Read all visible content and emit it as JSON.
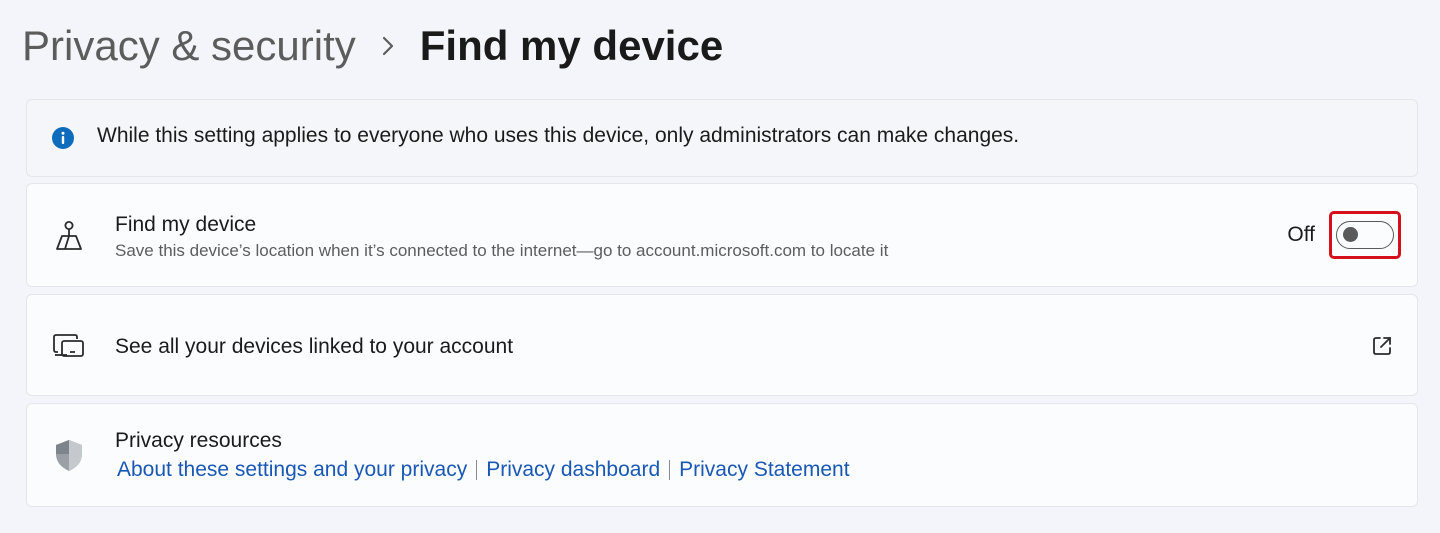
{
  "breadcrumb": {
    "parent": "Privacy & security",
    "current": "Find my device"
  },
  "info": {
    "icon": "info-icon",
    "text": "While this setting applies to everyone who uses this device, only administrators can make changes."
  },
  "find_my_device": {
    "icon": "person-location-icon",
    "title": "Find my device",
    "description": "Save this device’s location when it’s connected to the internet—go to account.microsoft.com to locate it",
    "toggle_state": "Off",
    "toggle_on": false
  },
  "linked_devices": {
    "icon": "devices-icon",
    "title": "See all your devices linked to your account",
    "action_icon": "open-external-icon"
  },
  "privacy_resources": {
    "icon": "shield-icon",
    "title": "Privacy resources",
    "links": [
      "About these settings and your privacy",
      "Privacy dashboard",
      "Privacy Statement"
    ]
  },
  "colors": {
    "accent_link": "#1958b4",
    "info_blue": "#0f6cbd",
    "highlight_red": "#d6101b",
    "background": "#f3f5fa"
  }
}
